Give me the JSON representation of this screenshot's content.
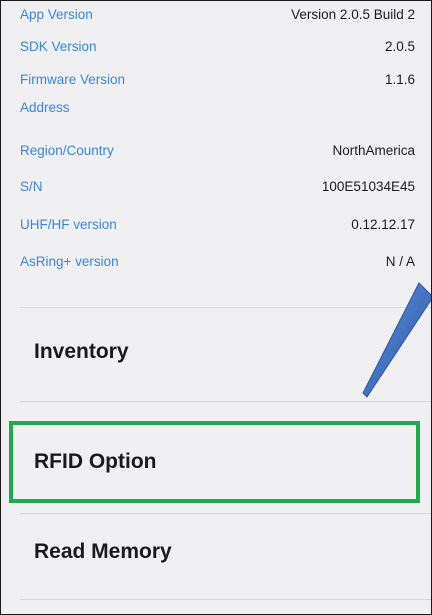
{
  "info": {
    "rows": [
      {
        "label": "App Version",
        "value": "Version 2.0.5 Build 2"
      },
      {
        "label": "SDK Version",
        "value": "2.0.5"
      },
      {
        "label": "Firmware Version",
        "value": "1.1.6"
      },
      {
        "label": "Address",
        "value": ""
      },
      {
        "label": "Region/Country",
        "value": "NorthAmerica"
      },
      {
        "label": "S/N",
        "value": "100E51034E45"
      },
      {
        "label": "UHF/HF version",
        "value": "0.12.12.17"
      },
      {
        "label": "AsRing+ version",
        "value": "N / A"
      }
    ]
  },
  "menu": {
    "items": [
      {
        "label": "Inventory"
      },
      {
        "label": "RFID Option"
      },
      {
        "label": "Read Memory"
      }
    ]
  },
  "annotations": {
    "highlight_color": "#22a94f",
    "callout_color": "#3f6fc0",
    "highlighted_item": "RFID Option"
  }
}
